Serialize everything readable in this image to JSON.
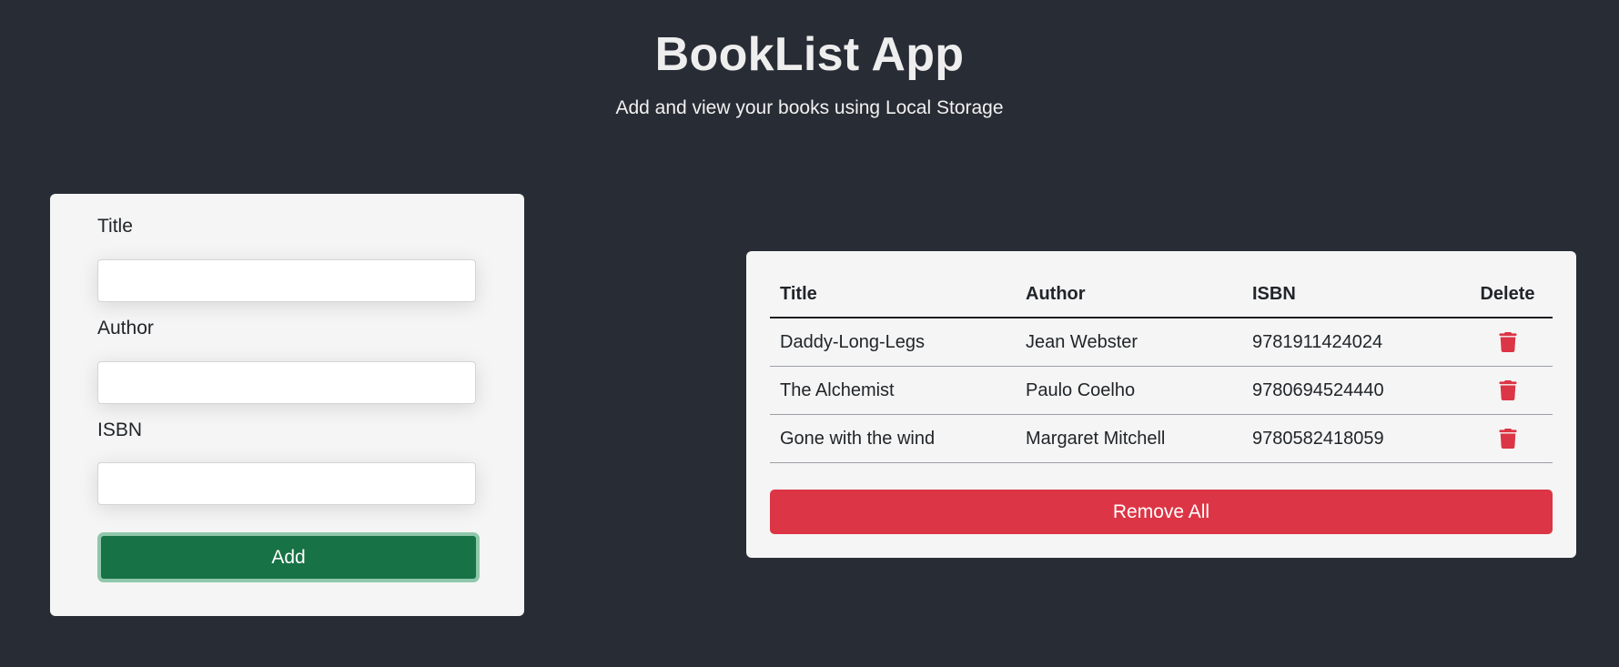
{
  "header": {
    "title": "BookList App",
    "subtitle": "Add and view your books using Local Storage"
  },
  "form": {
    "title_label": "Title",
    "title_value": "",
    "author_label": "Author",
    "author_value": "",
    "isbn_label": "ISBN",
    "isbn_value": "",
    "add_button_label": "Add"
  },
  "table": {
    "columns": [
      "Title",
      "Author",
      "ISBN",
      "Delete"
    ],
    "rows": [
      {
        "title": "Daddy-Long-Legs",
        "author": "Jean Webster",
        "isbn": "9781911424024",
        "delete_icon": "trash-icon"
      },
      {
        "title": "The Alchemist",
        "author": "Paulo Coelho",
        "isbn": "9780694524440",
        "delete_icon": "trash-icon"
      },
      {
        "title": "Gone with the wind",
        "author": "Margaret Mitchell",
        "isbn": "9780582418059",
        "delete_icon": "trash-icon"
      }
    ],
    "remove_all_label": "Remove All"
  },
  "colors": {
    "background": "#282c35",
    "card": "#f5f5f5",
    "add_button": "#177246",
    "add_button_focus_ring": "#8fc7ab",
    "danger": "#dc3545"
  }
}
